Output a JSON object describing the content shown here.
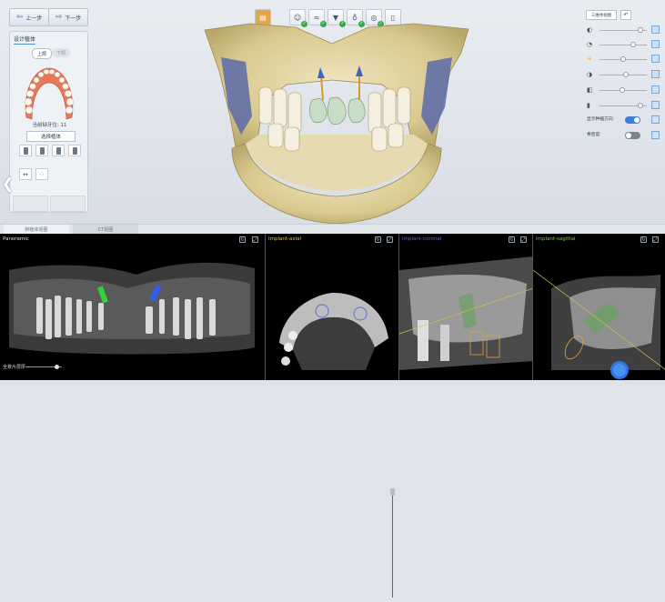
{
  "nav": {
    "prev_label": "上一步",
    "next_label": "下一步"
  },
  "design_panel": {
    "title": "设计植体",
    "seg_on": "上颌",
    "seg_off": "下颌",
    "missing_count_label": "当前缺牙位: 11",
    "select_btn": "选择植体"
  },
  "tabs": {
    "implant_view": "种植体视图",
    "ct_view": "CT视图"
  },
  "right_panel": {
    "view_select": "三维体视图",
    "reset_symbol": "↶",
    "sliders": [
      {
        "icon": "◐",
        "level": 0.87
      },
      {
        "icon": "◔",
        "level": 0.72
      },
      {
        "icon": "☀",
        "level": 0.5
      },
      {
        "icon": "◑",
        "level": 0.56
      },
      {
        "icon": "◧",
        "level": 0.48
      },
      {
        "icon": "▮",
        "level": 0.87
      }
    ],
    "toggle_direction_label": "显示种植方向",
    "toggle_direction_on": true,
    "toggle_bone_label": "骨密度",
    "toggle_bone_on": false
  },
  "panes": {
    "panoramic": {
      "title": "Panoramic",
      "color": "#dfe3e7",
      "slider_label": "全景片层厚",
      "slider_level": 0.85
    },
    "axial": {
      "title": "Implant-axial",
      "color": "#e8c34a"
    },
    "coronal": {
      "title": "Implant-coronal",
      "color": "#6b5bd6"
    },
    "sagittal": {
      "title": "Implant-sagittal",
      "color": "#7ccc3f"
    }
  },
  "colors": {
    "accent": "#2e6fc3",
    "toggle_on": "#3b7fd9",
    "toggle_off": "#7b8590"
  }
}
